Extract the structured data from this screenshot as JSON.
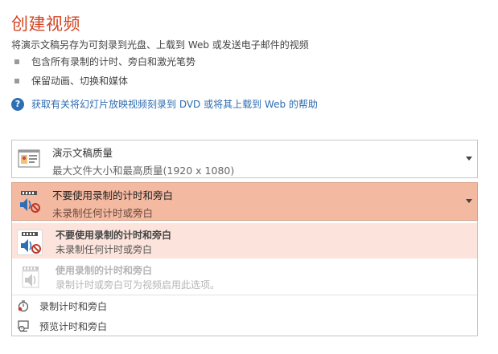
{
  "header": {
    "title": "创建视频",
    "subtitle": "将演示文稿另存为可刻录到光盘、上载到 Web 或发送电子邮件的视频",
    "bullets": [
      "包含所有录制的计时、旁白和激光笔势",
      "保留动画、切换和媒体"
    ],
    "help_link": "获取有关将幻灯片放映视频刻录到 DVD 或将其上载到 Web 的帮助"
  },
  "quality_select": {
    "label": "演示文稿质量",
    "description": "最大文件大小和最高质量(1920 x 1080)",
    "icon": "presentation-quality-icon"
  },
  "timing_select": {
    "label": "不要使用录制的计时和旁白",
    "description": "未录制任何计时或旁白",
    "icon": "film-audio-off-icon",
    "highlight_color": "#f4b9a1"
  },
  "dropdown": {
    "options": [
      {
        "label": "不要使用录制的计时和旁白",
        "description": "未录制任何计时或旁白",
        "icon": "film-audio-off-icon",
        "selected": true,
        "enabled": true
      },
      {
        "label": "使用录制的计时和旁白",
        "description": "录制计时或旁白可为视频启用此选项。",
        "icon": "film-audio-icon",
        "selected": false,
        "enabled": false
      }
    ],
    "commands": [
      {
        "label": "录制计时和旁白",
        "icon": "record-timing-icon"
      },
      {
        "label": "预览计时和旁白",
        "icon": "preview-timing-icon"
      }
    ]
  },
  "colors": {
    "accent": "#d24726",
    "link": "#2b6cb0",
    "selected_bg": "#fce4dc"
  }
}
